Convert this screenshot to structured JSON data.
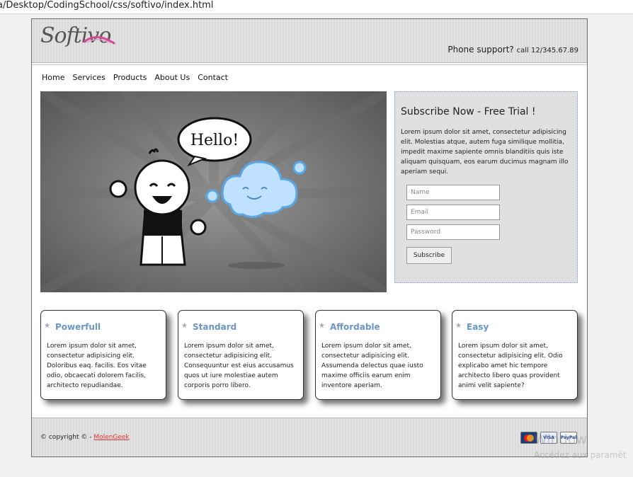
{
  "browser": {
    "url": "a/Desktop/CodingSchool/css/softivo/index.html"
  },
  "header": {
    "logo": "Softivo",
    "support_label": "Phone support?",
    "support_number": "call 12/345.67.89"
  },
  "nav": [
    "Home",
    "Services",
    "Products",
    "About Us",
    "Contact"
  ],
  "hero": {
    "bubble_text": "Hello!"
  },
  "subscribe": {
    "title": "Subscribe Now - Free Trial !",
    "text": "Lorem ipsum dolor sit amet, consectetur adipisicing elit. Molestias atque, autem fuga similique mollitia, impedit maxime sapiente omnis blanditiis quis iste aliquam quisquam, eos earum ducimus magnam illo aperiam sequi.",
    "name_placeholder": "Name",
    "email_placeholder": "Email",
    "password_placeholder": "Password",
    "button": "Subscribe"
  },
  "cards": [
    {
      "title": "Powerfull",
      "text": "Lorem ipsum dolor sit amet, consectetur adipisicing elit. Doloribus eaq. facilis. Eos vitae odio, obcaecati dolorem facilis, architecto repudiandae."
    },
    {
      "title": "Standard",
      "text": "Lorem ipsum dolor sit amet, consectetur adipisicing elit. Consequuntur est eius accusamus quos ut iure molestiae autem corporis porro libero."
    },
    {
      "title": "Affordable",
      "text": "Lorem ipsum dolor sit amet, consectetur adipisicing elit. Assumenda delectus quae iusto maxime officiis earum enim inventore aperiam."
    },
    {
      "title": "Easy",
      "text": "Lorem ipsum dolor sit amet, consectetur adipisicing elit. Odio explicabo amet hic tempore architecto libero quas provident animi velit sapiente?"
    }
  ],
  "footer": {
    "copyright": "© copyright © -",
    "link": "MolenGeek",
    "payments": [
      "mastercard-icon",
      "visa-icon",
      "paypal-icon"
    ],
    "payment_labels": [
      "Master",
      "VISA",
      "PayPal"
    ]
  },
  "watermark": {
    "line1": "Window",
    "line2": "Accédez aux paramèt"
  }
}
